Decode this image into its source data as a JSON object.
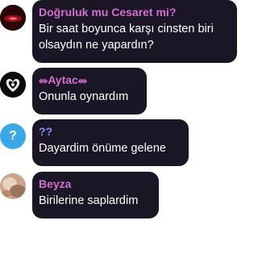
{
  "messages": [
    {
      "author": "Doğruluk mu Cesaret mi?",
      "text": "Bir saat boyunca karşı cinsten biri olsaydın ne yapardın?",
      "author_color": "#d46fcf",
      "avatar_icon": "red-glow-avatar"
    },
    {
      "author": "⥈Aytac⥈",
      "text": "Onunla oynardım",
      "author_color": "#d46fcf",
      "avatar_icon": "heart-emblem-avatar"
    },
    {
      "author": "??",
      "text": "Dayardim önüme gelene",
      "author_color": "#8b8cff",
      "avatar_icon": "question-mark-avatar",
      "avatar_glyph": "?"
    },
    {
      "author": "Beyza",
      "text": "Birilerine saplardim",
      "author_color": "#d46fcf",
      "avatar_icon": "photo-avatar"
    }
  ],
  "colors": {
    "bubble_bg": "#1a1625",
    "message_text": "#ffffff",
    "page_bg": "#ffffff"
  }
}
